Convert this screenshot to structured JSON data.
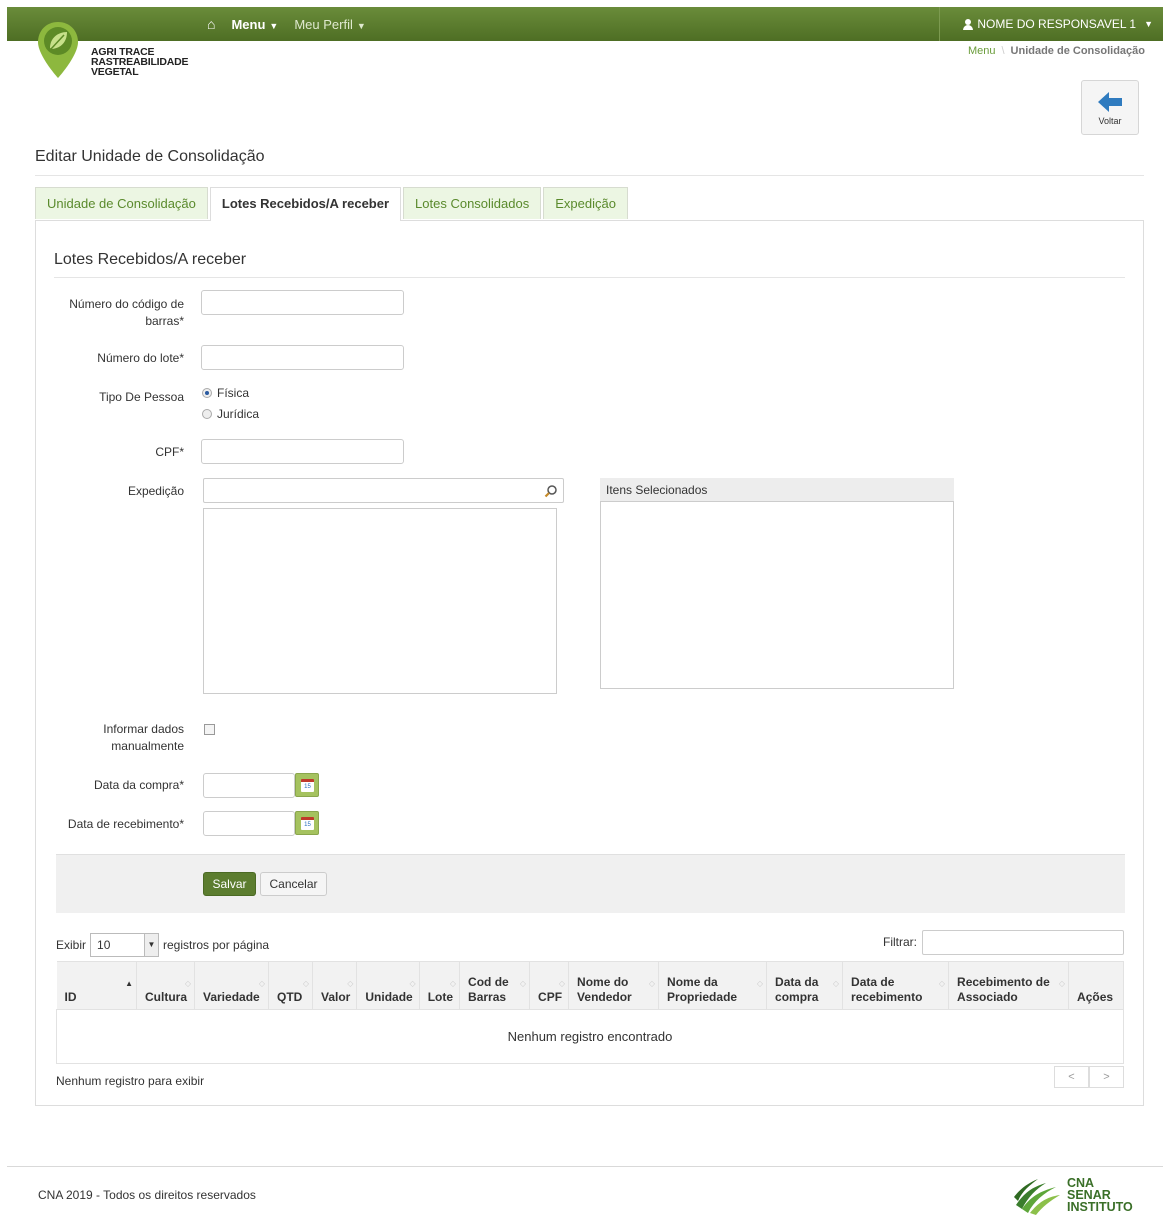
{
  "nav": {
    "menu_label": "Menu",
    "profile_label": "Meu Perfil",
    "user_label": "NOME DO RESPONSAVEL 1"
  },
  "logo": {
    "line1": "AGRI TRACE",
    "line2": "RASTREABILIDADE",
    "line3": "VEGETAL"
  },
  "breadcrumb": {
    "root": "Menu",
    "current": "Unidade de Consolidação"
  },
  "back_button": {
    "label": "Voltar"
  },
  "page_title": "Editar Unidade de Consolidação",
  "tabs": [
    {
      "label": "Unidade de Consolidação",
      "active": false
    },
    {
      "label": "Lotes Recebidos/A receber",
      "active": true
    },
    {
      "label": "Lotes Consolidados",
      "active": false
    },
    {
      "label": "Expedição",
      "active": false
    }
  ],
  "section_title": "Lotes Recebidos/A receber",
  "form": {
    "barcode_label": "Número do código de barras*",
    "barcode_value": "",
    "lot_label": "Número do lote*",
    "lot_value": "",
    "person_type_label": "Tipo De Pessoa",
    "person_type_options": [
      "Física",
      "Jurídica"
    ],
    "person_type_selected": "Física",
    "cpf_label": "CPF*",
    "cpf_value": "",
    "expedicao_label": "Expedição",
    "expedicao_search": "",
    "selected_items_header": "Itens Selecionados",
    "manual_label": "Informar dados manualmente",
    "manual_checked": false,
    "purchase_date_label": "Data da compra*",
    "purchase_date_value": "",
    "receipt_date_label": "Data de recebimento*",
    "receipt_date_value": "",
    "calendar_day": "15"
  },
  "buttons": {
    "save": "Salvar",
    "cancel": "Cancelar"
  },
  "table_controls": {
    "show_label": "Exibir",
    "page_size": "10",
    "per_page_label": "registros por página",
    "filter_label": "Filtrar:",
    "filter_value": ""
  },
  "table": {
    "columns": [
      "ID",
      "Cultura",
      "Variedade",
      "QTD",
      "Valor",
      "Unidade",
      "Lote",
      "Cod de Barras",
      "CPF",
      "Nome do Vendedor",
      "Nome da Propriedade",
      "Data da compra",
      "Data de recebimento",
      "Recebimento de Associado",
      "Ações"
    ],
    "empty_message": "Nenhum registro encontrado",
    "info": "Nenhum registro para exibir",
    "prev": "<",
    "next": ">"
  },
  "footer": {
    "copyright": "CNA 2019 - Todos os direitos reservados",
    "brand_line1": "CNA",
    "brand_line2": "SENAR",
    "brand_line3": "INSTITUTO"
  },
  "colors": {
    "topbar": "#5a7b2e",
    "accent": "#6a9c3a",
    "save_button": "#5c7d2f"
  }
}
